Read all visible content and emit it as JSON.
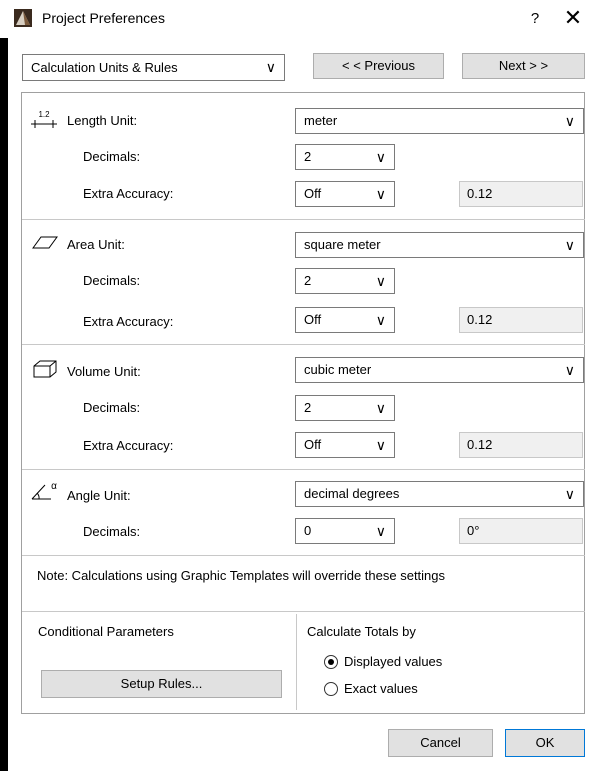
{
  "window": {
    "title": "Project Preferences",
    "help": "?",
    "close": "✕"
  },
  "top": {
    "page_select": "Calculation Units & Rules",
    "prev_label": "< < Previous",
    "next_label": "Next > >"
  },
  "chevron": "∨",
  "length": {
    "icon_text": "1.2",
    "unit_label": "Length Unit:",
    "unit_value": "meter",
    "decimals_label": "Decimals:",
    "decimals_value": "2",
    "accuracy_label": "Extra Accuracy:",
    "accuracy_value": "Off",
    "preview": "0.12"
  },
  "area": {
    "unit_label": "Area Unit:",
    "unit_value": "square meter",
    "decimals_label": "Decimals:",
    "decimals_value": "2",
    "accuracy_label": "Extra Accuracy:",
    "accuracy_value": "Off",
    "preview": "0.12"
  },
  "volume": {
    "unit_label": "Volume Unit:",
    "unit_value": "cubic meter",
    "decimals_label": "Decimals:",
    "decimals_value": "2",
    "accuracy_label": "Extra Accuracy:",
    "accuracy_value": "Off",
    "preview": "0.12"
  },
  "angle": {
    "icon_text": "α",
    "unit_label": "Angle Unit:",
    "unit_value": "decimal degrees",
    "decimals_label": "Decimals:",
    "decimals_value": "0",
    "preview": "0°"
  },
  "note": "Note: Calculations using Graphic Templates will override these settings",
  "conditional": {
    "label": "Conditional Parameters",
    "setup_label": "Setup Rules..."
  },
  "totals": {
    "label": "Calculate Totals by",
    "displayed": "Displayed values",
    "exact": "Exact values",
    "selected": "Displayed values"
  },
  "footer": {
    "cancel": "Cancel",
    "ok": "OK"
  }
}
